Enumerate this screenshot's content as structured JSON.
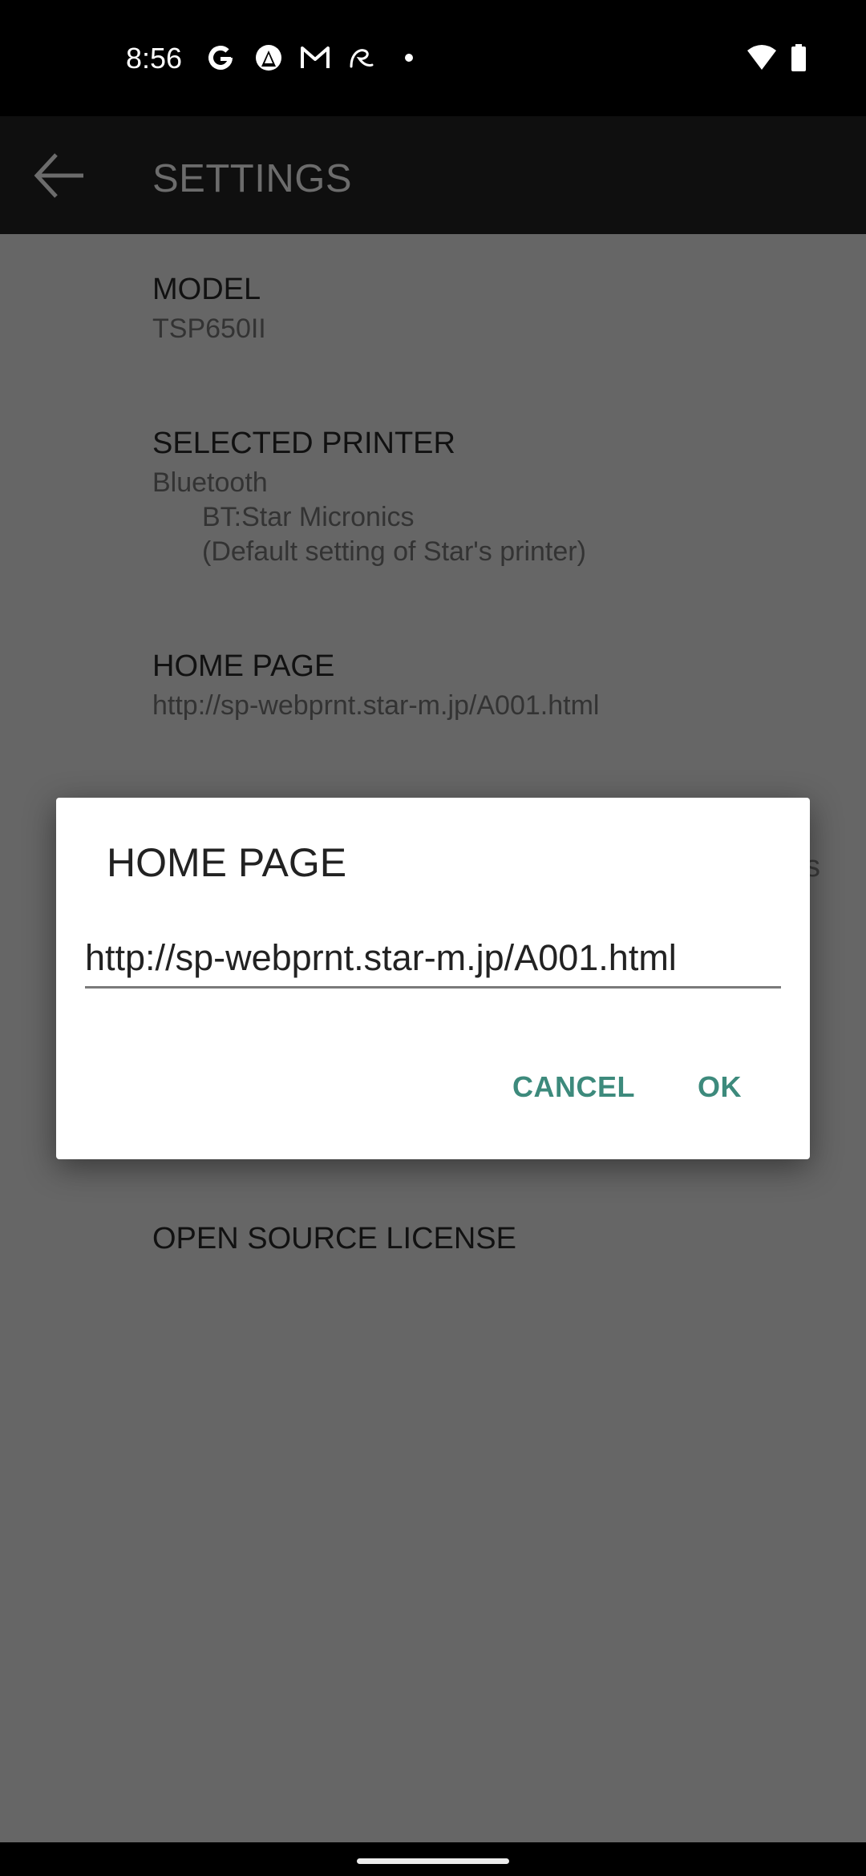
{
  "status_bar": {
    "time": "8:56",
    "notification_icons": [
      "google-icon",
      "app-icon",
      "gmail-icon",
      "signature-icon",
      "dot-icon"
    ],
    "system_icons": [
      "wifi-icon",
      "battery-icon"
    ]
  },
  "toolbar": {
    "back_icon": "arrow-left-icon",
    "title": "SETTINGS"
  },
  "settings": {
    "items": [
      {
        "title": "MODEL",
        "summary": [
          "TSP650II"
        ]
      },
      {
        "title": "SELECTED PRINTER",
        "summary": [
          "Bluetooth",
          "BT:Star Micronics",
          "(Default setting of Star's printer)"
        ]
      },
      {
        "title": "HOME PAGE",
        "summary": [
          "http://sp-webprnt.star-m.jp/A001.html"
        ]
      },
      {
        "title": "OPEN SOURCE LICENSE",
        "summary": []
      }
    ],
    "obscured_text_fragment": "s"
  },
  "dialog": {
    "title": "HOME PAGE",
    "input_value": "http://sp-webprnt.star-m.jp/A001.html",
    "cancel_label": "CANCEL",
    "ok_label": "OK",
    "accent_color": "#3d8a7c"
  }
}
